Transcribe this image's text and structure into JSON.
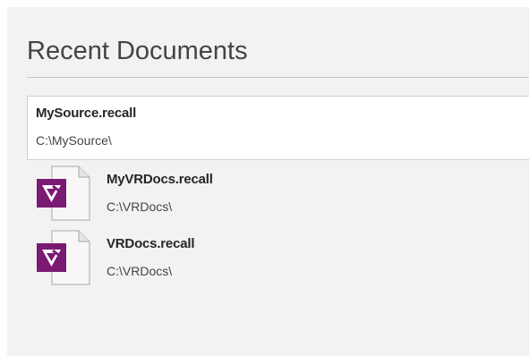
{
  "recent": {
    "title": "Recent Documents",
    "items": [
      {
        "name": "MySource.recall",
        "path": "C:\\MySource\\",
        "icon": "recall-file-icon",
        "selected": true
      },
      {
        "name": "MyVRDocs.recall",
        "path": "C:\\VRDocs\\",
        "icon": "recall-file-icon",
        "selected": false
      },
      {
        "name": "VRDocs.recall",
        "path": "C:\\VRDocs\\",
        "icon": "recall-file-icon",
        "selected": false
      }
    ]
  },
  "colors": {
    "panel_bg": "#f2f2f2",
    "selected_bg": "#ffffff",
    "icon_brand": "#7a1a73"
  }
}
